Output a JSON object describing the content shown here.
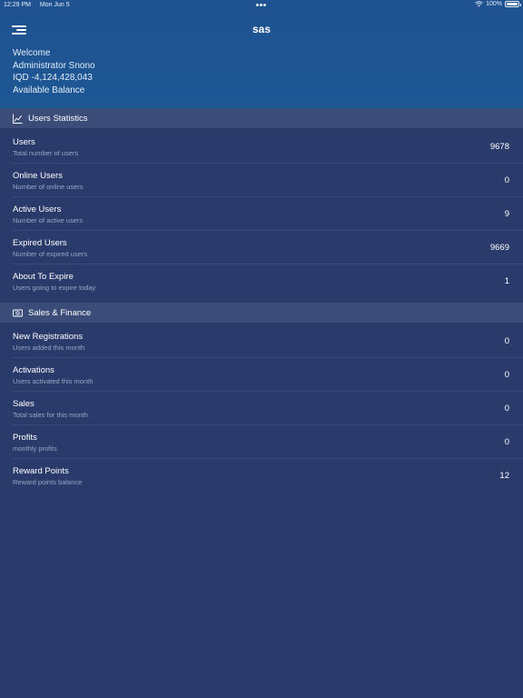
{
  "status_bar": {
    "time": "12:29 PM",
    "date": "Mon Jun 5",
    "battery": "100%"
  },
  "header": {
    "title": "sas",
    "welcome": "Welcome",
    "user_name": "Administrator Snono",
    "balance": "IQD -4,124,428,043",
    "balance_label": "Available Balance"
  },
  "users_statistics": {
    "title": "Users Statistics",
    "icon": "line-chart-icon",
    "items": [
      {
        "title": "Users",
        "subtitle": "Total number of users",
        "value": "9678"
      },
      {
        "title": "Online Users",
        "subtitle": "Number of online users",
        "value": "0"
      },
      {
        "title": "Active Users",
        "subtitle": "Number of active users",
        "value": "9"
      },
      {
        "title": "Expired Users",
        "subtitle": "Number of expired users",
        "value": "9669"
      },
      {
        "title": "About To Expire",
        "subtitle": "Users going to expire today",
        "value": "1"
      }
    ]
  },
  "sales_finance": {
    "title": "Sales & Finance",
    "icon": "money-icon",
    "items": [
      {
        "title": "New Registrations",
        "subtitle": "Users added this month",
        "value": "0"
      },
      {
        "title": "Activations",
        "subtitle": "Users activated this month",
        "value": "0"
      },
      {
        "title": "Sales",
        "subtitle": "Total sales for this month",
        "value": "0"
      },
      {
        "title": "Profits",
        "subtitle": "monthly profits",
        "value": "0"
      },
      {
        "title": "Reward Points",
        "subtitle": "Reward points balance",
        "value": "12"
      }
    ]
  },
  "colors": {
    "header_bg": "#1e5290",
    "body_bg": "#2a3a6a",
    "section_bg": "#3b4c79"
  }
}
